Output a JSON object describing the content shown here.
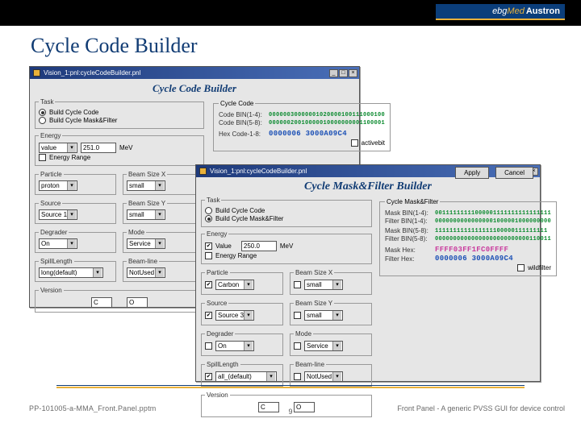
{
  "brand": {
    "pre": "ebg",
    "mid": "Med",
    "post": "Austron"
  },
  "slide": {
    "title": "Cycle Code Builder",
    "footer_left": "PP-101005-a-MMA_Front.Panel.pptm",
    "footer_center": "9",
    "footer_right": "Front Panel - A generic PVSS GUI for device control"
  },
  "dlg1": {
    "title": "Vision_1:pnl:cycleCodeBuilder.pnl",
    "header": "Cycle Code Builder",
    "task_radio1": "Build Cycle Code",
    "task_radio2": "Build Cycle Mask&Filter",
    "groups": {
      "task": "Task",
      "energy": "Energy",
      "particle": "Particle",
      "beamsize_x": "Beam Size X",
      "source": "Source",
      "beamsize_y": "Beam Size Y",
      "degrader": "Degrader",
      "mode": "Mode",
      "spillength": "SpillLength",
      "beamline": "Beam-line",
      "version": "Version",
      "cyclecode": "Cycle Code",
      "energy_unit": "MeV"
    },
    "values": {
      "energy": "value",
      "energy_val": "251.0",
      "energy_chk": "Energy Range",
      "particle": "proton",
      "beamsize_x": "small",
      "source": "Source 1",
      "beamsize_y": "small",
      "degrader": "On",
      "mode": "Service",
      "spillength": "long(default)",
      "beamline": "NotUsed",
      "version_c": "C",
      "version_o": "O"
    },
    "code": {
      "lbl1": "Code BIN(1-4):",
      "lbl2": "Code BIN(5-8):",
      "lbl_hex": "Hex Code-1-8:",
      "bin1": "00000030000001020000100111000100",
      "bin2": "00000020010000010000000001100001",
      "hex": "0000006 3000A09C4",
      "activebit": "activebit"
    }
  },
  "dlg2": {
    "title": "Vision_1:pnl:cycleCodeBuilder.pnl",
    "header": "Cycle Mask&Filter Builder",
    "groups": {
      "task": "Task",
      "energy": "Energy",
      "particle": "Particle",
      "beamsize_x": "Beam Size X",
      "source": "Source",
      "beamsize_y": "Beam Size Y",
      "degrader": "Degrader",
      "mode": "Mode",
      "spillength": "SpillLength",
      "beamline": "Beam-line",
      "version": "Version",
      "cyclemask": "Cycle Mask&Filter",
      "energy_unit": "MeV"
    },
    "values": {
      "energy_chk": "Value",
      "energy_val": "250.0",
      "particle": "Carbon",
      "beamsize_x": "small",
      "source": "Source 3",
      "beamsize_y": "small",
      "degrader": "On",
      "mode": "Service",
      "spillength": "all_(default)",
      "beamline": "NotUsed",
      "version_c": "C",
      "version_o": "O"
    },
    "code": {
      "lbl_mask14": "Mask BIN(1-4):",
      "lbl_filt14": "Filter BIN(1-4):",
      "lbl_mask58": "Mask BIN(5-8):",
      "lbl_filt58": "Filter BIN(5-8):",
      "lbl_maskhex": "Mask Hex:",
      "lbl_filthex": "Filter Hex:",
      "mask14": "00111111111000001111111111111111",
      "filt14": "00000000000000001000001000000000",
      "mask58": "1111111111111111100000111111111",
      "filt58": "00000000000000000000000000110011",
      "maskhex": "FFFF03FF1FC0FFFF",
      "filthex": "0000006 3000A09C4",
      "wildfilter": "wildfilter"
    },
    "buttons": {
      "apply": "Apply",
      "cancel": "Cancel"
    }
  }
}
